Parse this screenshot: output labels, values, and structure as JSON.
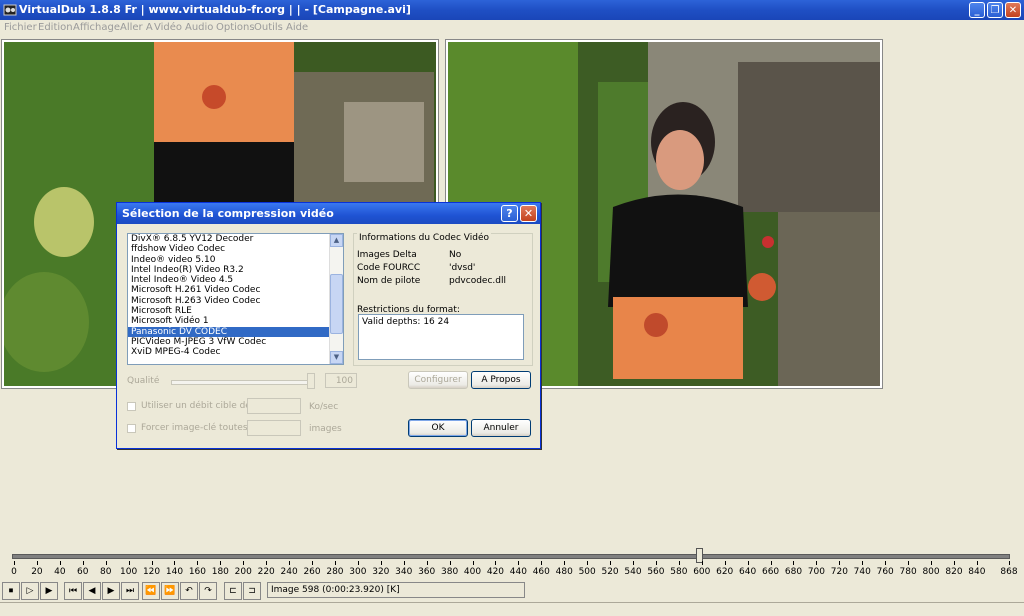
{
  "window": {
    "title": "VirtualDub 1.8.8 Fr  |  www.virtualdub-fr.org  |  |  - [Campagne.avi]",
    "min_icon": "minimize-icon",
    "max_icon": "restore-icon",
    "close_icon": "close-icon"
  },
  "menu": [
    "Fichier",
    "Edition",
    "Affichage",
    "Aller A",
    "Vidéo",
    "Audio",
    "Options",
    "Outils",
    "Aide"
  ],
  "dialog": {
    "title": "Sélection de la compression vidéo",
    "help_glyph": "?",
    "close_glyph": "✕",
    "codecs": [
      "DivX® 6.8.5 YV12 Decoder",
      "ffdshow Video Codec",
      "Indeo® video 5.10",
      "Intel Indeo(R) Video R3.2",
      "Intel Indeo® Video 4.5",
      "Microsoft H.261 Video Codec",
      "Microsoft H.263 Video Codec",
      "Microsoft RLE",
      "Microsoft Vidéo 1",
      "Panasonic DV CODEC",
      "PICVideo M-JPEG 3 VfW Codec",
      "XviD MPEG-4 Codec"
    ],
    "selected_index": 9,
    "info_group_label": "Informations du Codec Vidéo",
    "images_delta_label": "Images Delta",
    "images_delta_value": "No",
    "fourcc_label": "Code FOURCC",
    "fourcc_value": "'dvsd'",
    "driver_label": "Nom de pilote",
    "driver_value": "pdvcodec.dll",
    "restrictions_label": "Restrictions du format:",
    "restrictions_value": "Valid depths: 16 24",
    "quality_label": "Qualité",
    "quality_value": "100",
    "configure_button": "Configurer",
    "about_button": "A Propos",
    "target_rate_label": "Utiliser un débit cible de",
    "target_rate_unit": "Ko/sec",
    "keyframe_label": "Forcer image-clé toutes les",
    "keyframe_unit": "images",
    "ok_button": "OK",
    "cancel_button": "Annuler"
  },
  "timeline": {
    "ticks": [
      "0",
      "20",
      "40",
      "60",
      "80",
      "100",
      "120",
      "140",
      "160",
      "180",
      "200",
      "220",
      "240",
      "260",
      "280",
      "300",
      "320",
      "340",
      "360",
      "380",
      "400",
      "420",
      "440",
      "460",
      "480",
      "500",
      "520",
      "540",
      "560",
      "580",
      "600",
      "620",
      "640",
      "660",
      "680",
      "700",
      "720",
      "740",
      "760",
      "780",
      "800",
      "820",
      "840",
      "868"
    ],
    "total_frames": 868,
    "current_frame": 598,
    "frame_text": "Image 598 (0:00:23.920) [K]"
  },
  "toolbar_icons": [
    "stop-icon",
    "play-input-icon",
    "play-output-icon",
    "start-icon",
    "prev-frame-icon",
    "next-frame-icon",
    "end-icon",
    "prev-key-icon",
    "next-key-icon",
    "scene-back-icon",
    "scene-forward-icon",
    "mark-in-icon",
    "mark-out-icon"
  ]
}
